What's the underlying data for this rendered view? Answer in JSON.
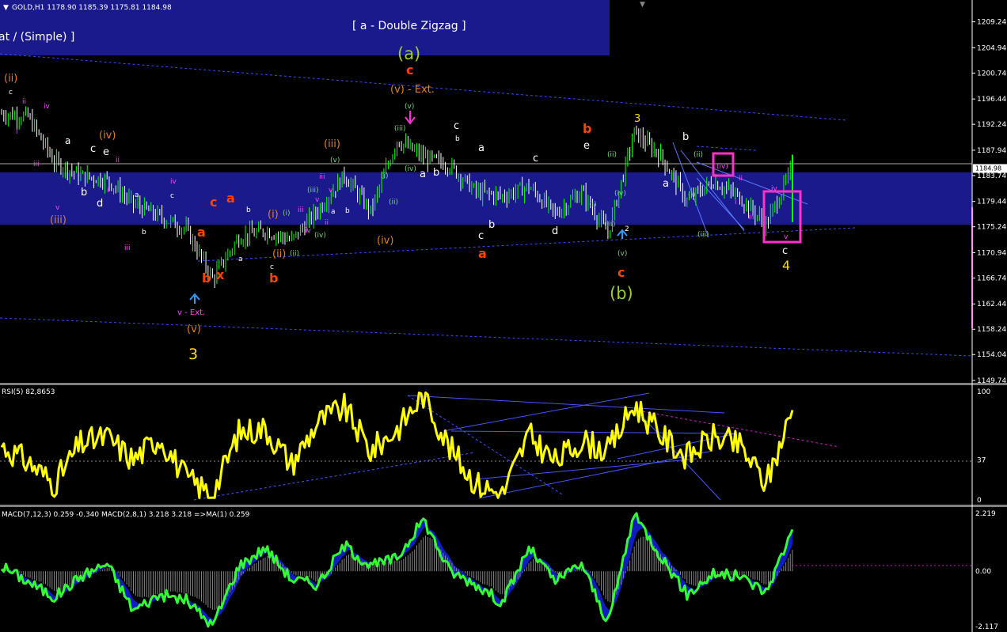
{
  "window": {
    "header_text": "GOLD,H1  1178.90 1185.39 1175.81 1184.98",
    "menu_arrow_icon": "triangle-down-icon",
    "shift_marker_icon": "triangle-down-icon"
  },
  "price_pane": {
    "banner_top_left": "at / (Simple) ]",
    "banner_top_center": "[ a - Double Zigzag ]",
    "price_ticks": [
      "1209.24",
      "1204.94",
      "1200.74",
      "1196.44",
      "1192.24",
      "1187.94",
      "1183.74",
      "1179.44",
      "1175.24",
      "1170.94",
      "1166.74",
      "1162.44",
      "1158.24",
      "1154.04",
      "1149.74"
    ],
    "current_price": "1184.98",
    "colors": {
      "bull": "#00ff00",
      "bear": "#ffffff",
      "band": "#1a1a8c",
      "trend": "#3a4aff",
      "box": "#ff33cc"
    }
  },
  "wave_labels": [
    {
      "t": "(ii)",
      "c": "#e08020"
    },
    {
      "t": "c",
      "c": "#ffffff"
    },
    {
      "t": "ii",
      "c": "#ff44ff"
    },
    {
      "t": "i",
      "c": "#ff44ff"
    },
    {
      "t": "iv",
      "c": "#ff44ff"
    },
    {
      "t": "iii",
      "c": "#ff44ff"
    },
    {
      "t": "a",
      "c": "#ffffff"
    },
    {
      "t": "v",
      "c": "#ff44ff"
    },
    {
      "t": "(iii)",
      "c": "#e08020"
    },
    {
      "t": "b",
      "c": "#ffffff"
    },
    {
      "t": "(iv)",
      "c": "#e08020"
    },
    {
      "t": "c",
      "c": "#ffffff"
    },
    {
      "t": "e",
      "c": "#ffffff"
    },
    {
      "t": "ii",
      "c": "#ff44ff"
    },
    {
      "t": "d",
      "c": "#ffffff"
    },
    {
      "t": "i",
      "c": "#ff44ff"
    },
    {
      "t": "iii",
      "c": "#ff44ff"
    },
    {
      "t": "a",
      "c": "#ffffff"
    },
    {
      "t": "b",
      "c": "#ffffff"
    },
    {
      "t": "iv",
      "c": "#ff44ff"
    },
    {
      "t": "c",
      "c": "#ffffff"
    },
    {
      "t": "a",
      "c": "#ff4400"
    },
    {
      "t": "b",
      "c": "#ff4400"
    },
    {
      "t": "c",
      "c": "#ff4400"
    },
    {
      "t": "x",
      "c": "#ff4400"
    },
    {
      "t": "a",
      "c": "#ff4400"
    },
    {
      "t": "v - Ext.",
      "c": "#ff44ff"
    },
    {
      "t": "(v)",
      "c": "#e08020"
    },
    {
      "t": "3",
      "c": "#ffdd00"
    },
    {
      "t": "b",
      "c": "#ffffff"
    },
    {
      "t": "a",
      "c": "#ffffff"
    },
    {
      "t": "c",
      "c": "#ffffff"
    },
    {
      "t": "b",
      "c": "#ff4400"
    },
    {
      "t": "(ii)",
      "c": "#e08020"
    },
    {
      "t": "(i)",
      "c": "#e08020"
    },
    {
      "t": "(i)",
      "c": "#7fd07f"
    },
    {
      "t": "(ii)",
      "c": "#7fd07f"
    },
    {
      "t": "(iii)",
      "c": "#e08020"
    },
    {
      "t": "(v)",
      "c": "#7fd07f"
    },
    {
      "t": "(iii)",
      "c": "#7fd07f"
    },
    {
      "t": "iii",
      "c": "#ff44ff"
    },
    {
      "t": "iv",
      "c": "#ff44ff"
    },
    {
      "t": "v",
      "c": "#ff44ff"
    },
    {
      "t": "(iv)",
      "c": "#7fd07f"
    },
    {
      "t": "iii",
      "c": "#ff44ff"
    },
    {
      "t": "v",
      "c": "#ff44ff"
    },
    {
      "t": "ii",
      "c": "#ff44ff"
    },
    {
      "t": "a",
      "c": "#ffffff"
    },
    {
      "t": "b",
      "c": "#ffffff"
    },
    {
      "t": "(iv)",
      "c": "#e08020"
    },
    {
      "t": "(a)",
      "c": "#9acd32"
    },
    {
      "t": "c",
      "c": "#ff4400"
    },
    {
      "t": "(v) - Ext.",
      "c": "#e08020"
    },
    {
      "t": "(v)",
      "c": "#7fd07f"
    },
    {
      "t": "(iii)",
      "c": "#7fd07f"
    },
    {
      "t": "(i)",
      "c": "#7fd07f"
    },
    {
      "t": "(ii)",
      "c": "#7fd07f"
    },
    {
      "t": "(iv)",
      "c": "#7fd07f"
    },
    {
      "t": "a",
      "c": "#ffffff"
    },
    {
      "t": "b",
      "c": "#ffffff"
    },
    {
      "t": "c",
      "c": "#ffffff"
    },
    {
      "t": "b",
      "c": "#ffffff"
    },
    {
      "t": "a",
      "c": "#ffffff"
    },
    {
      "t": "c",
      "c": "#ffffff"
    },
    {
      "t": "b",
      "c": "#ffffff"
    },
    {
      "t": "a",
      "c": "#ff4400"
    },
    {
      "t": "c",
      "c": "#ffffff"
    },
    {
      "t": "d",
      "c": "#ffffff"
    },
    {
      "t": "b",
      "c": "#ff4400"
    },
    {
      "t": "e",
      "c": "#ffffff"
    },
    {
      "t": "(i)",
      "c": "#7fd07f"
    },
    {
      "t": "(ii)",
      "c": "#7fd07f"
    },
    {
      "t": "(iii)",
      "c": "#7fd07f"
    },
    {
      "t": "(iv)",
      "c": "#7fd07f"
    },
    {
      "t": "(v)",
      "c": "#7fd07f"
    },
    {
      "t": "2",
      "c": "#ffffff"
    },
    {
      "t": "c",
      "c": "#ff4400"
    },
    {
      "t": "(b)",
      "c": "#9acd32"
    },
    {
      "t": "3",
      "c": "#ffdd00"
    },
    {
      "t": "b",
      "c": "#ffffff"
    },
    {
      "t": "a",
      "c": "#ffffff"
    },
    {
      "t": "(ii)",
      "c": "#7fd07f"
    },
    {
      "t": "(i)",
      "c": "#7fd07f"
    },
    {
      "t": "(iii)",
      "c": "#7fd07f"
    },
    {
      "t": "(iv)",
      "c": "#ff44ff"
    },
    {
      "t": "ii",
      "c": "#ff44ff"
    },
    {
      "t": "i",
      "c": "#ff44ff"
    },
    {
      "t": "iii",
      "c": "#ff44ff"
    },
    {
      "t": "iv",
      "c": "#ff44ff"
    },
    {
      "t": "v",
      "c": "#ff44ff"
    },
    {
      "t": "c",
      "c": "#ffffff"
    },
    {
      "t": "4",
      "c": "#ffdd00"
    }
  ],
  "rsi_pane": {
    "header_text": "RSI(5) 82,8653",
    "ticks": [
      "100",
      "37",
      "0"
    ],
    "line_color": "#ffff00"
  },
  "macd_pane": {
    "header_text": "MACD(7,12,3) 0.259 -0.340  MACD(2,8,1) 3.218 3.218  =>MA(1) 0.259",
    "ticks": [
      "2.219",
      "0.00",
      "-2.117"
    ],
    "line_color": "#33ff33",
    "hist_color": "#888888",
    "area_color": "#1020d0"
  },
  "chart_data": [
    {
      "type": "line",
      "title": "GOLD,H1",
      "ylim": [
        1149.74,
        1210.5
      ],
      "x": [
        "1",
        "13",
        "25",
        "37",
        "49",
        "61",
        "73",
        "85",
        "97",
        "109",
        "121",
        "133",
        "145",
        "157",
        "169",
        "181",
        "193",
        "205",
        "217",
        "229",
        "241",
        "253",
        "265",
        "277",
        "289",
        "301",
        "313",
        "325",
        "337",
        "349",
        "361"
      ],
      "series": [
        {
          "values": [
            1194.0,
            1193.5,
            1186.0,
            1183.7,
            1183.0,
            1179.0,
            1176.9,
            1174.8,
            1166.6,
            1173.5,
            1174.6,
            1173.0,
            1178.0,
            1183.8,
            1177.8,
            1189.6,
            1186.8,
            1185.4,
            1181.0,
            1180.3,
            1181.9,
            1177.4,
            1181.0,
            1174.2,
            1190.9,
            1187.0,
            1179.5,
            1182.8,
            1180.1,
            1175.6,
            1184.98
          ]
        }
      ]
    },
    {
      "type": "line",
      "title": "RSI(5) 82,8653",
      "ylim": [
        0,
        100
      ],
      "series": [
        {
          "values": [
            50,
            35,
            15,
            52,
            58,
            37,
            58,
            20,
            5,
            62,
            66,
            33,
            72,
            85,
            45,
            65,
            97,
            48,
            15,
            5,
            60,
            35,
            55,
            45,
            88,
            60,
            40,
            58,
            50,
            15,
            82.87
          ]
        }
      ]
    },
    {
      "type": "line",
      "title": "MACD(7,12,3) 0.259 -0.340  MACD(2,8,1) 3.218 3.218  =>MA(1) 0.259",
      "ylim": [
        -2.117,
        2.219
      ],
      "series": [
        {
          "values": [
            0.2,
            -0.4,
            -1.0,
            -0.2,
            0.3,
            -1.5,
            -0.9,
            -1.1,
            -2.1,
            0.2,
            0.9,
            -0.3,
            -0.5,
            1.0,
            0.2,
            0.5,
            2.0,
            0.0,
            -0.5,
            -1.2,
            0.9,
            -0.4,
            0.3,
            -2.0,
            2.2,
            0.6,
            -0.9,
            -0.1,
            -0.2,
            -0.8,
            1.6
          ]
        }
      ]
    }
  ]
}
